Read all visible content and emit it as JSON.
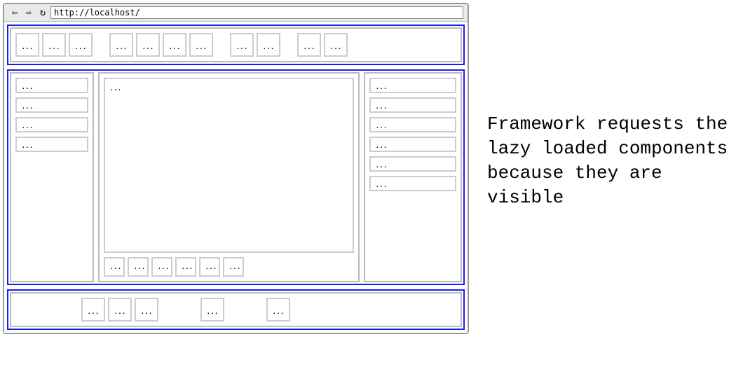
{
  "browser": {
    "url": "http://localhost/",
    "nav": {
      "back": "⇦",
      "forward": "⇨",
      "reload": "↻"
    }
  },
  "ellipsis": "...",
  "header_groups": [
    3,
    4,
    2,
    2
  ],
  "left_sidebar_items": 4,
  "right_sidebar_items": 6,
  "main_pager_items": 6,
  "footer_clusters": [
    3,
    1,
    1
  ],
  "caption": "Framework requests the lazy loaded components because they are visible"
}
